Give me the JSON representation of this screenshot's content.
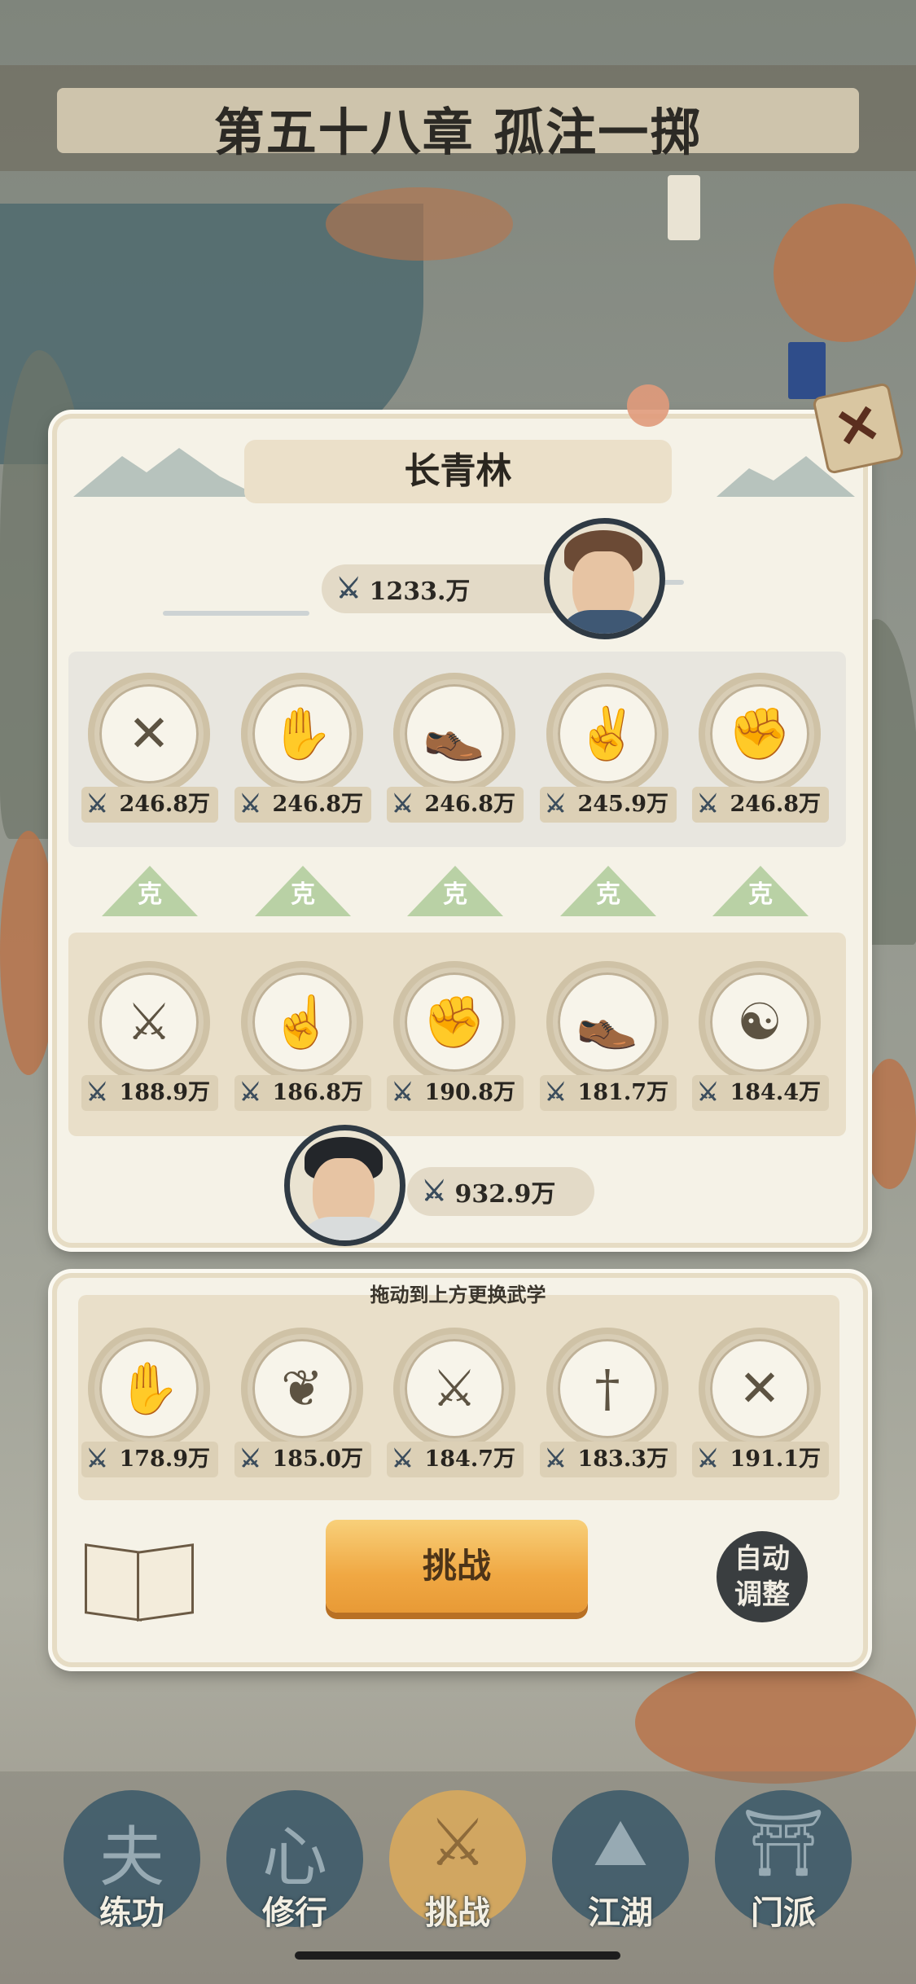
{
  "chapter": {
    "title": "第五十八章 孤注一掷"
  },
  "stage": {
    "name": "长青林",
    "close_icon": "close-scroll-icon"
  },
  "enemy": {
    "power": "1233.万",
    "avatar": "male-warrior-portrait"
  },
  "player": {
    "power": "932.9万",
    "avatar": "female-warrior-portrait"
  },
  "sword_icon": "crossed-swords-icon",
  "enemy_slots": [
    {
      "icon": "crossed-spears-icon",
      "glyph": "✕",
      "value": "246.8万"
    },
    {
      "icon": "open-palm-icon",
      "glyph": "✋",
      "value": "246.8万"
    },
    {
      "icon": "shoe-icon",
      "glyph": "👞",
      "value": "246.8万"
    },
    {
      "icon": "two-finger-icon",
      "glyph": "✌",
      "value": "245.9万"
    },
    {
      "icon": "fist-icon",
      "glyph": "✊",
      "value": "246.8万"
    }
  ],
  "counters": [
    "克",
    "克",
    "克",
    "克",
    "克"
  ],
  "player_slots": [
    {
      "icon": "throwing-daggers-icon",
      "glyph": "⚔",
      "value": "188.9万"
    },
    {
      "icon": "finger-point-icon",
      "glyph": "☝",
      "value": "186.8万"
    },
    {
      "icon": "fist-icon",
      "glyph": "✊",
      "value": "190.8万"
    },
    {
      "icon": "shoe-icon",
      "glyph": "👞",
      "value": "181.7万"
    },
    {
      "icon": "meditation-icon",
      "glyph": "☯",
      "value": "184.4万"
    }
  ],
  "reserve": {
    "hint": "拖动到上方更换武学",
    "slots": [
      {
        "icon": "open-palm-icon",
        "glyph": "✋",
        "value": "178.9万"
      },
      {
        "icon": "feather-icon",
        "glyph": "❦",
        "value": "185.0万"
      },
      {
        "icon": "saber-icon",
        "glyph": "⚔",
        "value": "184.7万"
      },
      {
        "icon": "sword-icon",
        "glyph": "†",
        "value": "183.3万"
      },
      {
        "icon": "crossed-spears-icon",
        "glyph": "✕",
        "value": "191.1万"
      }
    ]
  },
  "actions": {
    "challenge": "挑战",
    "auto_adjust_line1": "自动",
    "auto_adjust_line2": "调整",
    "book_icon": "martial-book-icon"
  },
  "nav": [
    {
      "label": "练功",
      "icon": "training-icon",
      "glyph": "夫"
    },
    {
      "label": "修行",
      "icon": "heart-cultivation-icon",
      "glyph": "心"
    },
    {
      "label": "挑战",
      "icon": "crossed-swords-icon",
      "glyph": "⚔",
      "active": true
    },
    {
      "label": "江湖",
      "icon": "mountain-icon",
      "glyph": "⛰"
    },
    {
      "label": "门派",
      "icon": "gate-icon",
      "glyph": "⛩"
    }
  ],
  "colors": {
    "accent": "#f0a843",
    "panel": "#f5f2e7",
    "counter": "#b9d1a5"
  }
}
